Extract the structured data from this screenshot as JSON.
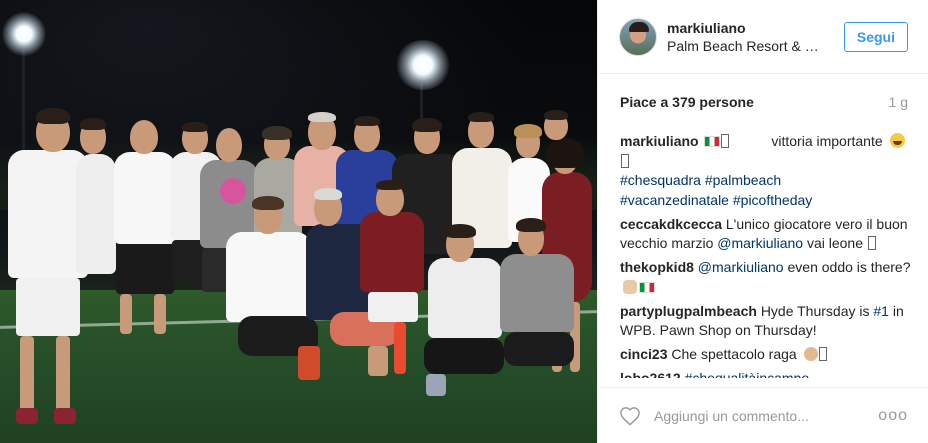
{
  "post": {
    "username": "markiuliano",
    "location": "Palm Beach Resort & Beach Club",
    "follow_label": "Segui",
    "likes": "Piace a 379 persone",
    "time_ago": "1 g"
  },
  "comments": [
    {
      "user": "markiuliano",
      "text": "vittoria importante",
      "tags": [
        "#chesquadra",
        "#palmbeach",
        "#vacanzedinatale",
        "#picoftheday"
      ]
    },
    {
      "user": "ceccakdkcecca",
      "text_before": "L'unico giocatore vero il buon vecchio marzio ",
      "mention": "@markiuliano",
      "text_after": " vai leone "
    },
    {
      "user": "thekopkid8",
      "mention": "@markiuliano",
      "text_after": " even oddo is there?"
    },
    {
      "user": "partyplugpalmbeach",
      "text_before": "Hyde Thursday is ",
      "tag": "#1",
      "text_after": " in WPB. Pawn Shop on Thursday!"
    },
    {
      "user": "cinci23",
      "text": "Che spettacolo raga"
    },
    {
      "user": "lobo2612",
      "tag": "#chequalitàincampo"
    }
  ],
  "footer": {
    "comment_placeholder": "Aggiungi un commento...",
    "more_label": "ooo"
  },
  "colors": {
    "accent_blue": "#3897f0",
    "hashtag": "#003569",
    "muted": "#999999",
    "text": "#262626"
  }
}
